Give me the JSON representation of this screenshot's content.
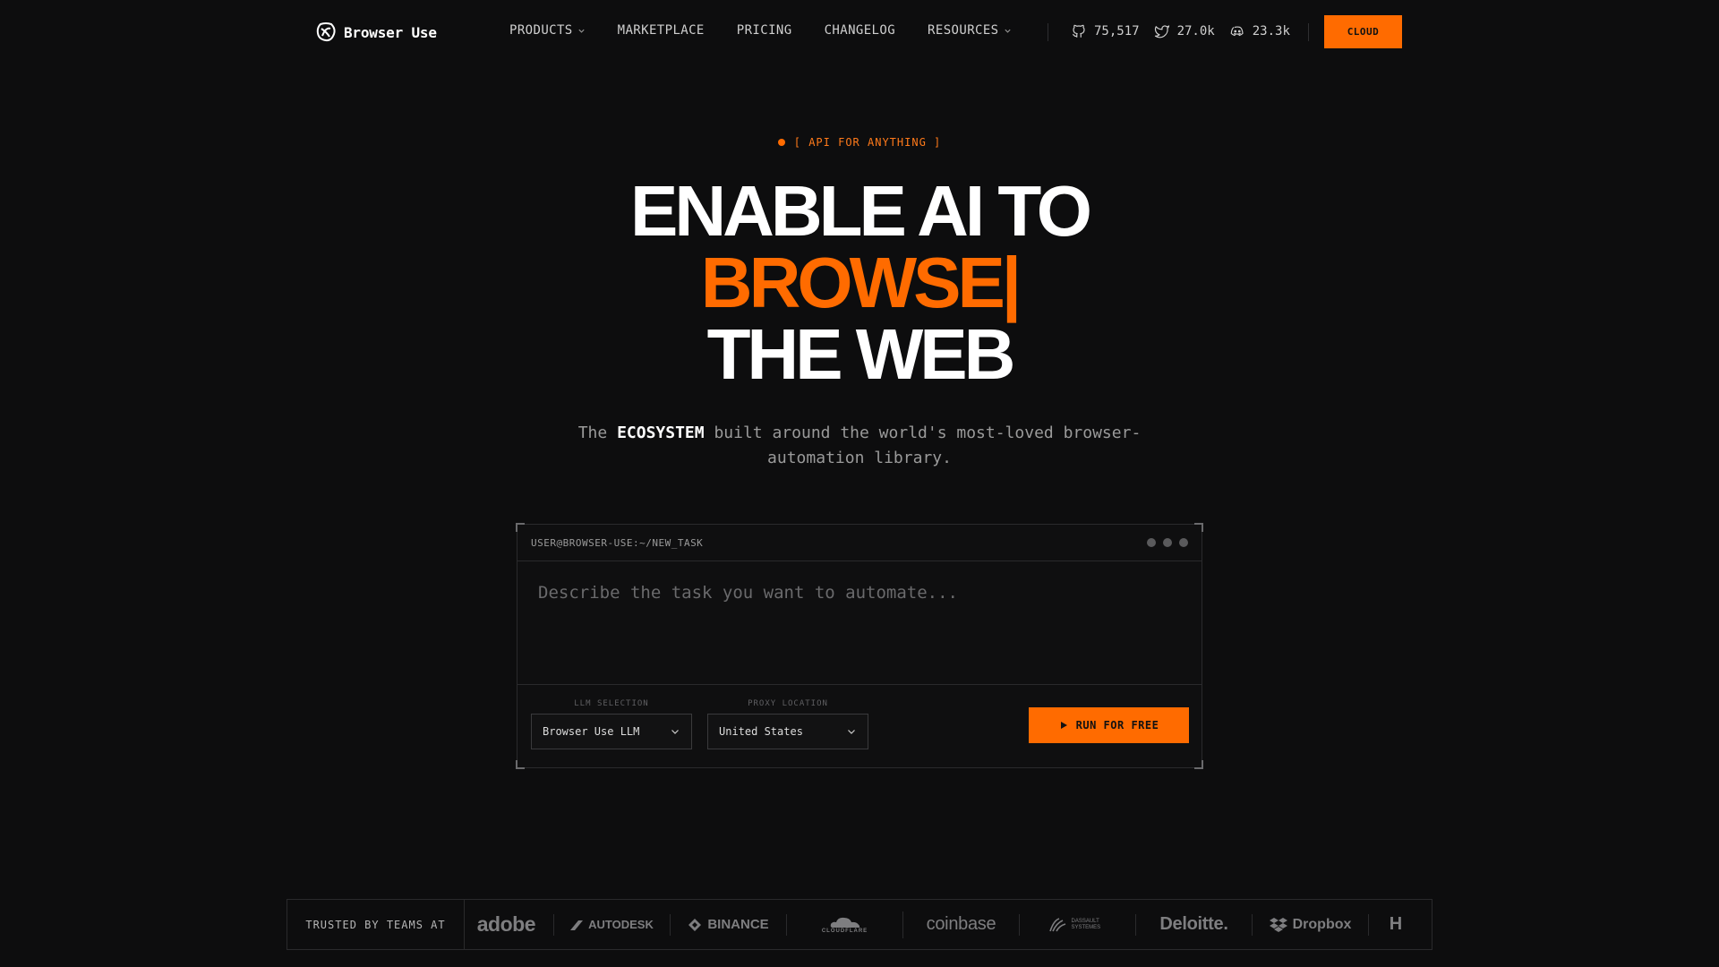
{
  "nav": {
    "brand": "Browser Use",
    "links": [
      {
        "label": "PRODUCTS",
        "dropdown": true
      },
      {
        "label": "MARKETPLACE",
        "dropdown": false
      },
      {
        "label": "PRICING",
        "dropdown": false
      },
      {
        "label": "CHANGELOG",
        "dropdown": false
      },
      {
        "label": "RESOURCES",
        "dropdown": true
      }
    ],
    "stats": {
      "github": {
        "icon": "github-icon",
        "value": "75,517"
      },
      "twitter": {
        "icon": "twitter-icon",
        "value": "27.0k"
      },
      "discord": {
        "icon": "discord-icon",
        "value": "23.3k"
      }
    },
    "cta": "CLOUD"
  },
  "hero": {
    "tag": "[ API FOR ANYTHING ]",
    "line1": "ENABLE AI TO",
    "line2": "BROWSE|",
    "line3": "THE WEB",
    "subtitle_pre": "The",
    "subtitle_bold": "ECOSYSTEM",
    "subtitle_post": "built around the world's most-loved browser-automation library."
  },
  "terminal": {
    "path": "USER@BROWSER-USE:~/NEW_TASK",
    "placeholder": "Describe the task you want to automate...",
    "llm_label": "LLM SELECTION",
    "llm_value": "Browser Use LLM",
    "proxy_label": "PROXY LOCATION",
    "proxy_value": "United States",
    "run_label": "RUN FOR FREE"
  },
  "trusted": {
    "label": "TRUSTED BY TEAMS AT",
    "brands": [
      "adobe",
      "AUTODESK",
      "BINANCE",
      "CLOUDFLARE",
      "coinbase",
      "DASSAULT SYSTEMES",
      "Deloitte.",
      "Dropbox",
      "H"
    ]
  },
  "colors": {
    "accent": "#ff6b00",
    "background": "#0d0d0e"
  }
}
